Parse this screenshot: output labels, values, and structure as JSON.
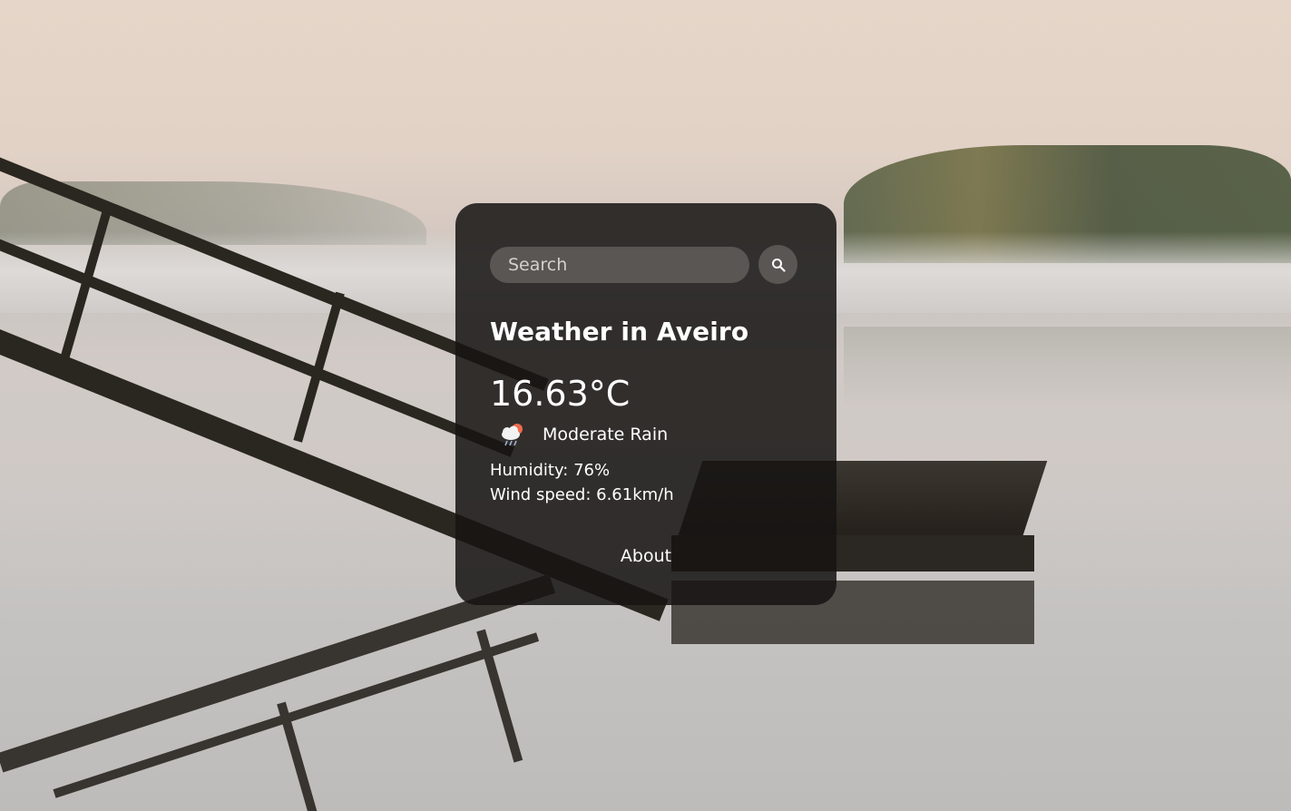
{
  "search": {
    "placeholder": "Search",
    "value": ""
  },
  "weather": {
    "title": "Weather in Aveiro",
    "temperature": "16.63°C",
    "description": "Moderate Rain",
    "icon": "cloud-rain-sun-icon",
    "humidity": "Humidity: 76%",
    "wind": "Wind speed: 6.61km/h"
  },
  "footer": {
    "about_label": "About"
  },
  "colors": {
    "card_background": "#161413",
    "text": "#ffffff",
    "input_background": "#7a7672"
  }
}
